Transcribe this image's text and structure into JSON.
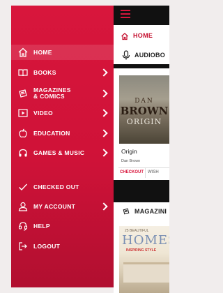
{
  "drawer": {
    "items": [
      {
        "label": "HOME",
        "icon": "home-icon",
        "active": true,
        "chevron": false
      },
      {
        "label": "BOOKS",
        "icon": "book-open-icon",
        "chevron": true
      },
      {
        "label": "MAGAZINES\n& COMICS",
        "icon": "magazine-icon",
        "chevron": true
      },
      {
        "label": "VIDEO",
        "icon": "play-icon",
        "chevron": true
      },
      {
        "label": "EDUCATION",
        "icon": "apple-icon",
        "chevron": true
      },
      {
        "label": "GAMES & MUSIC",
        "icon": "headphones-icon",
        "chevron": true
      },
      {
        "label": "CHECKED OUT",
        "icon": "checkmark-icon",
        "chevron": false
      },
      {
        "label": "MY ACCOUNT",
        "icon": "user-icon",
        "chevron": true
      },
      {
        "label": "HELP",
        "icon": "headset-icon",
        "chevron": false
      },
      {
        "label": "LOGOUT",
        "icon": "logout-icon",
        "chevron": false
      }
    ]
  },
  "app": {
    "home_title": "HOME",
    "audiobooks": {
      "heading": "AUDIOBO",
      "cover_author_first": "DAN",
      "cover_author_last": "BROWN",
      "cover_title": "ORIGIN",
      "book_title": "Origin",
      "book_author": "Dan Brown",
      "action_checkout": "CHECKOUT",
      "action_wishlist": "WISH"
    },
    "magazines": {
      "heading": "MAGAZINI",
      "cover_kicker": "25 BEAUTIFUL",
      "cover_title": "HOMES",
      "cover_tag": "INSPIRING STYLE"
    }
  },
  "colors": {
    "brand_red": "#d8163c",
    "drawer_dark": "#b10f30"
  }
}
